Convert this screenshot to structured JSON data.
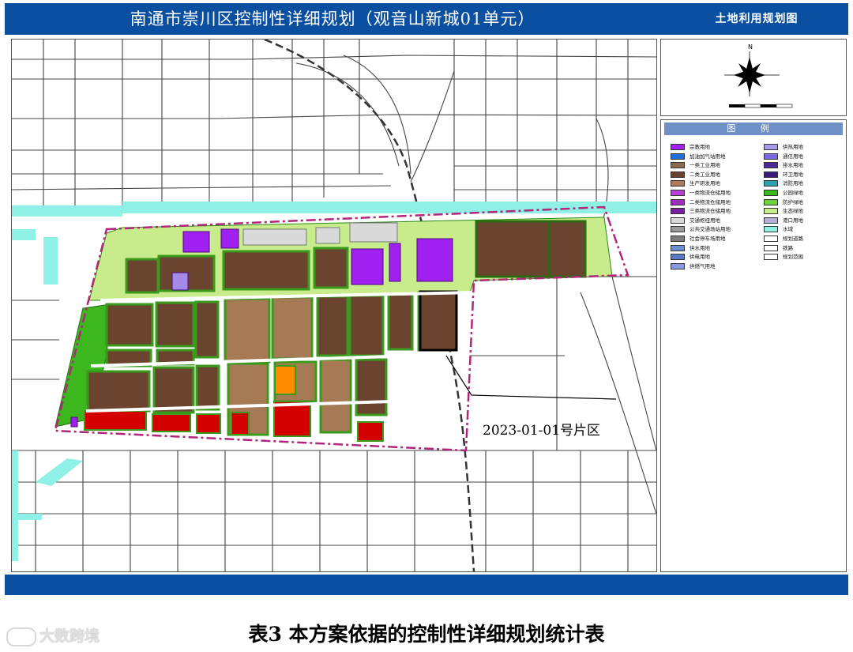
{
  "header": {
    "title": "南通市崇川区控制性详细规划（观音山新城01单元）",
    "map_type": "土地利用规划图"
  },
  "compass": {
    "north_label": "N"
  },
  "legend": {
    "title": "图 例",
    "left_items": [
      {
        "label": "宗教用地",
        "color": "#a020f0"
      },
      {
        "label": "加油加气站用地",
        "color": "#1e6fd9"
      },
      {
        "label": "一类工业用地",
        "color": "#8c6a4f"
      },
      {
        "label": "二类工业用地",
        "color": "#6b4430"
      },
      {
        "label": "生产研发用地",
        "color": "#b07a5a"
      },
      {
        "label": "一类物流仓储用地",
        "color": "#b83fd6"
      },
      {
        "label": "二类物流仓储用地",
        "color": "#9a2fc0"
      },
      {
        "label": "三类物流仓储用地",
        "color": "#7a1fa0"
      },
      {
        "label": "交通枢纽用地",
        "color": "#d9d9d9"
      },
      {
        "label": "公共交通场站用地",
        "color": "#9a9a9a"
      },
      {
        "label": "社会停车场用地",
        "color": "#7d7d7d"
      },
      {
        "label": "供水用地",
        "color": "#6a8ed6"
      },
      {
        "label": "供电用地",
        "color": "#5a78c8"
      },
      {
        "label": "供燃气用地",
        "color": "#8a9ae0"
      }
    ],
    "right_items": [
      {
        "label": "供热用地",
        "color": "#a89ae8"
      },
      {
        "label": "通信用地",
        "color": "#7a6ae0"
      },
      {
        "label": "排水用地",
        "color": "#4a2a9a"
      },
      {
        "label": "环卫用地",
        "color": "#3a1a7a"
      },
      {
        "label": "消防用地",
        "color": "#2aa0b0"
      },
      {
        "label": "公园绿地",
        "color": "#3cb81e"
      },
      {
        "label": "防护绿地",
        "color": "#6fd23c"
      },
      {
        "label": "生态绿地",
        "color": "#c8ec8c"
      },
      {
        "label": "港口用地",
        "color": "#b0b0d8"
      },
      {
        "label": "水域",
        "color": "#8ff0e6"
      },
      {
        "label": "规划道路",
        "color": "#ffffff"
      },
      {
        "label": "铁路",
        "color": "#ffffff"
      },
      {
        "label": "规划范围",
        "color": "#ffffff"
      }
    ]
  },
  "map": {
    "annotation": "2023-01-01号片区",
    "colors": {
      "water": "#8ff0e6",
      "industrial_dark": "#6b4430",
      "industrial_light": "#a57a55",
      "green_park": "#3cb81e",
      "green_eco": "#c8ec8c",
      "red": "#d40000",
      "purple": "#a020f0",
      "orange": "#ff8c00",
      "boundary": "#b0267a"
    }
  },
  "caption": "表3  本方案依据的控制性详细规划统计表",
  "watermark": "大数跨境"
}
